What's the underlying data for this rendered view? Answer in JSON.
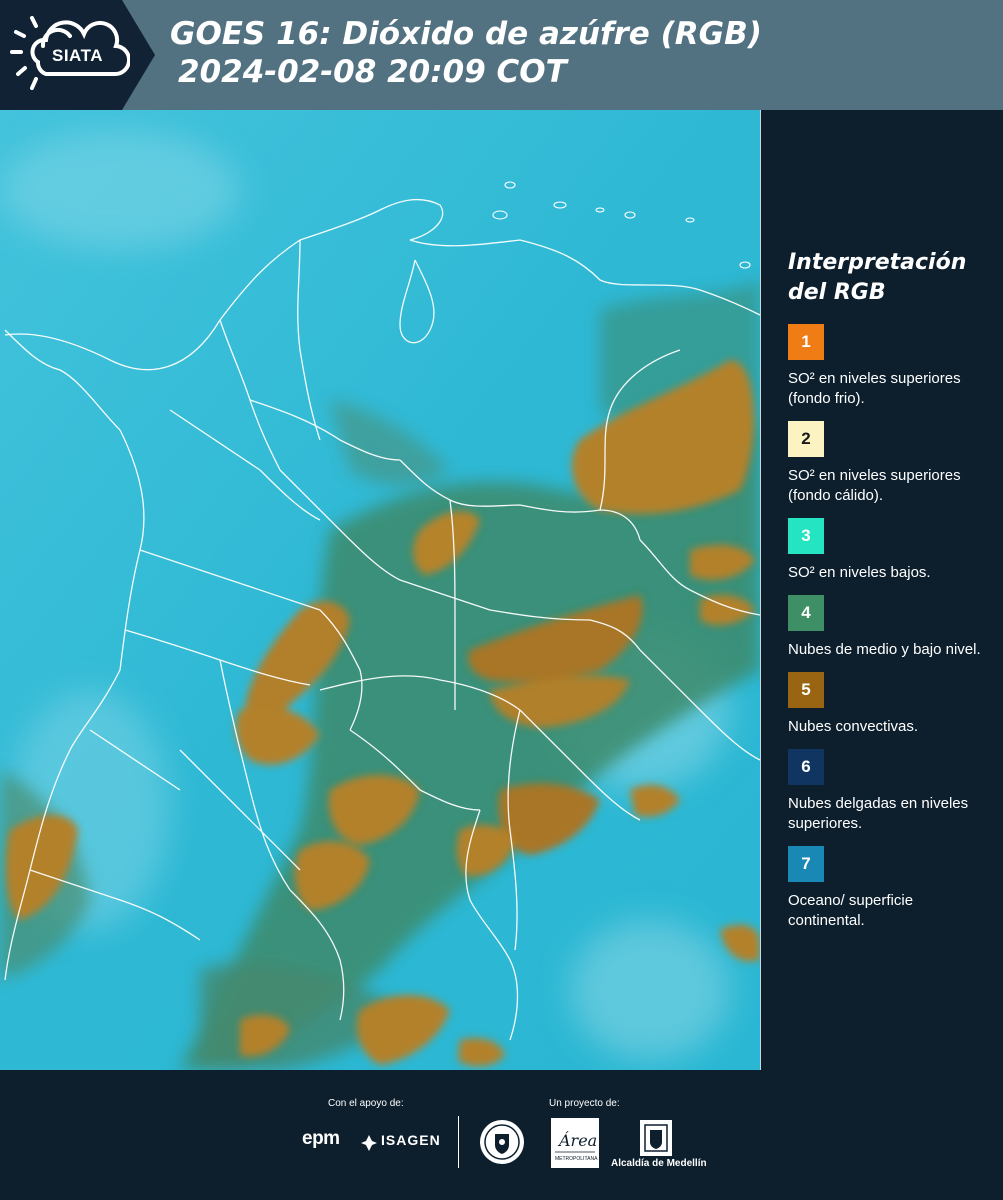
{
  "header": {
    "logo_text": "SIATA",
    "title_line1": "GOES 16: Dióxido de azúfre (RGB)",
    "title_line2": "2024-02-08 20:09 COT"
  },
  "legend": {
    "title_line1": "Interpretación",
    "title_line2": "del RGB",
    "items": [
      {
        "number": "1",
        "color": "#f07c16",
        "text": "SO² en niveles superiores (fondo frio)."
      },
      {
        "number": "2",
        "color": "#fbf4c2",
        "text": "SO² en niveles superiores (fondo cálido)."
      },
      {
        "number": "3",
        "color": "#25e4c2",
        "text": "SO² en niveles bajos."
      },
      {
        "number": "4",
        "color": "#3f8f66",
        "text": "Nubes de medio y bajo nivel."
      },
      {
        "number": "5",
        "color": "#9a6512",
        "text": "Nubes convectivas."
      },
      {
        "number": "6",
        "color": "#0f3560",
        "text": "Nubes delgadas en niveles superiores."
      },
      {
        "number": "7",
        "color": "#1988b4",
        "text": "Oceano/ superficie continental."
      }
    ]
  },
  "footer": {
    "support_label": "Con el apoyo de:",
    "project_label": "Un proyecto de:",
    "epm": "epm",
    "isagen": "ISAGEN",
    "area_text": "Área",
    "area_subtext": "METROPOLITANA",
    "alcaldia": "Alcaldía de Medellín"
  },
  "colors": {
    "map_background": "#2fb9d4",
    "cloud_convective": "#b3812a",
    "cloud_mid": "#4b8a62",
    "boundary": "#ffffff"
  }
}
